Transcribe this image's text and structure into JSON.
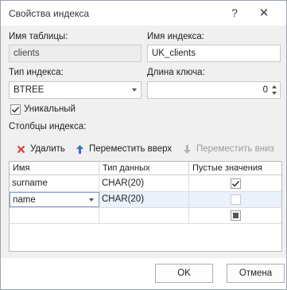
{
  "dialog": {
    "title": "Свойства индекса",
    "help_glyph": "?",
    "close_glyph": "✕"
  },
  "form": {
    "table_name_label": "Имя таблицы:",
    "table_name_value": "clients",
    "index_name_label": "Имя индекса:",
    "index_name_value": "UK_clients",
    "index_type_label": "Тип индекса:",
    "index_type_value": "BTREE",
    "key_length_label": "Длина ключа:",
    "key_length_value": "0",
    "unique_label": "Уникальный",
    "unique_checked": true,
    "columns_label": "Столбцы индекса:"
  },
  "toolbar": {
    "delete_label": "Удалить",
    "move_up_label": "Переместить вверх",
    "move_down_label": "Переместить вниз",
    "delete_icon": "x-icon",
    "move_up_icon": "arrow-up-icon",
    "move_down_icon": "arrow-down-icon",
    "accent_red": "#e03a2e",
    "accent_blue": "#2f6fc7"
  },
  "grid": {
    "headers": [
      "Имя",
      "Тип данных",
      "Пустые значения"
    ],
    "rows": [
      {
        "name": "surname",
        "type": "CHAR(20)",
        "nullable": "checked"
      },
      {
        "name": "name",
        "type": "CHAR(20)",
        "nullable": "unchecked"
      },
      {
        "name": "",
        "type": "",
        "nullable": "indeterminate"
      }
    ]
  },
  "footer": {
    "ok_label": "OK",
    "cancel_label": "Отмена"
  }
}
